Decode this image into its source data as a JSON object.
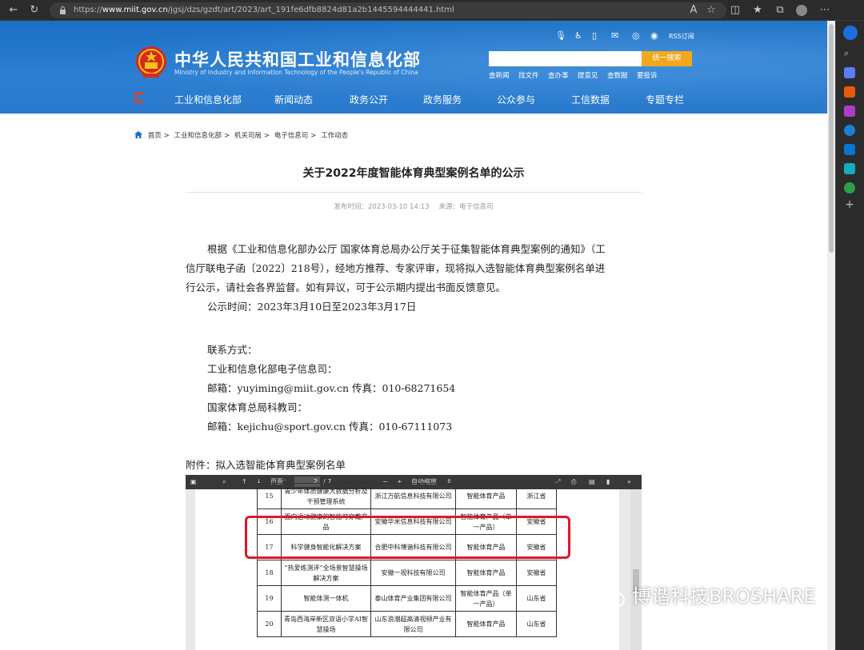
{
  "browser": {
    "url_prefix": "https://",
    "url_domain": "www.miit.gov.cn",
    "url_path": "/jgsj/dzs/gzdt/art/2023/art_191fe6dfb8824d81a2b1445594444441.html"
  },
  "header": {
    "title_cn": "中华人民共和国工业和信息化部",
    "title_en": "Ministry of Industry and Information Technology of the People's Republic of China",
    "rss": "RSS订阅",
    "search_button": "统一搜索",
    "quick_links": [
      "查新闻",
      "找文件",
      "查办事",
      "提意见",
      "查数据",
      "要投诉"
    ],
    "nav": [
      "工业和信息化部",
      "新闻动态",
      "政务公开",
      "政务服务",
      "公众参与",
      "工信数据",
      "专题专栏"
    ]
  },
  "breadcrumb": [
    "首页",
    "工业和信息化部",
    "机关司局",
    "电子信息司",
    "工作动态"
  ],
  "article": {
    "title": "关于2022年度智能体育典型案例名单的公示",
    "publish_label": "发布时间：2023-03-10 14:13",
    "source_label": "来源：电子信息司",
    "para1_l1": "根据《工业和信息化部办公厅 国家体育总局办公厅关于征集智能体育典型案例的通知》（工",
    "para1_l2": "信厅联电子函〔2022〕218号），经地方推荐、专家评审，现将拟入选智能体育典型案例名单进",
    "para1_l3": "行公示，请社会各界监督。如有异议，可于公示期内提出书面反馈意见。",
    "period": "公示时间：2023年3月10日至2023年3月17日",
    "contact_title": "联系方式：",
    "org1": "工业和信息化部电子信息司：",
    "contact1": "邮箱：yuyiming@miit.gov.cn  传真：010-68271654",
    "org2": "国家体育总局科教司：",
    "contact2": "邮箱：kejichu@sport.gov.cn  传真：010-67111073",
    "attachment": "附件：拟入选智能体育典型案例名单"
  },
  "pdf": {
    "page_label": "页面：",
    "page_current": "2",
    "page_total": "/ 7",
    "zoom": "自动缩放",
    "rows": [
      {
        "no": "15",
        "name": "青少年体质健康大数据分析及干预管理系统",
        "org": "浙江万航信息科技有限公司",
        "type": "智能体育产品",
        "region": "浙江省"
      },
      {
        "no": "16",
        "name": "面向运动健康的智能可穿戴产品",
        "org": "安徽华米信息科技有限公司",
        "type": "智能体育产品（单一产品）",
        "region": "安徽省"
      },
      {
        "no": "17",
        "name": "科学健身智能化解决方案",
        "org": "合肥中科博谐科技有限公司",
        "type": "智能体育产品",
        "region": "安徽省"
      },
      {
        "no": "18",
        "name": "“热爱练测评”全场景智慧操场解决方案",
        "org": "安徽一视科技有限公司",
        "type": "智能体育产品",
        "region": "安徽省"
      },
      {
        "no": "19",
        "name": "智能体测一体机",
        "org": "泰山体育产业集团有限公司",
        "type": "智能体育产品（单一产品）",
        "region": "山东省"
      },
      {
        "no": "20",
        "name": "青岛西海岸新区双语小学AI智慧操场",
        "org": "山东浪潮超高清视频产业有限公司",
        "type": "智能体育产品",
        "region": "山东省"
      }
    ]
  },
  "watermark": "博谐科技BROSHARE"
}
